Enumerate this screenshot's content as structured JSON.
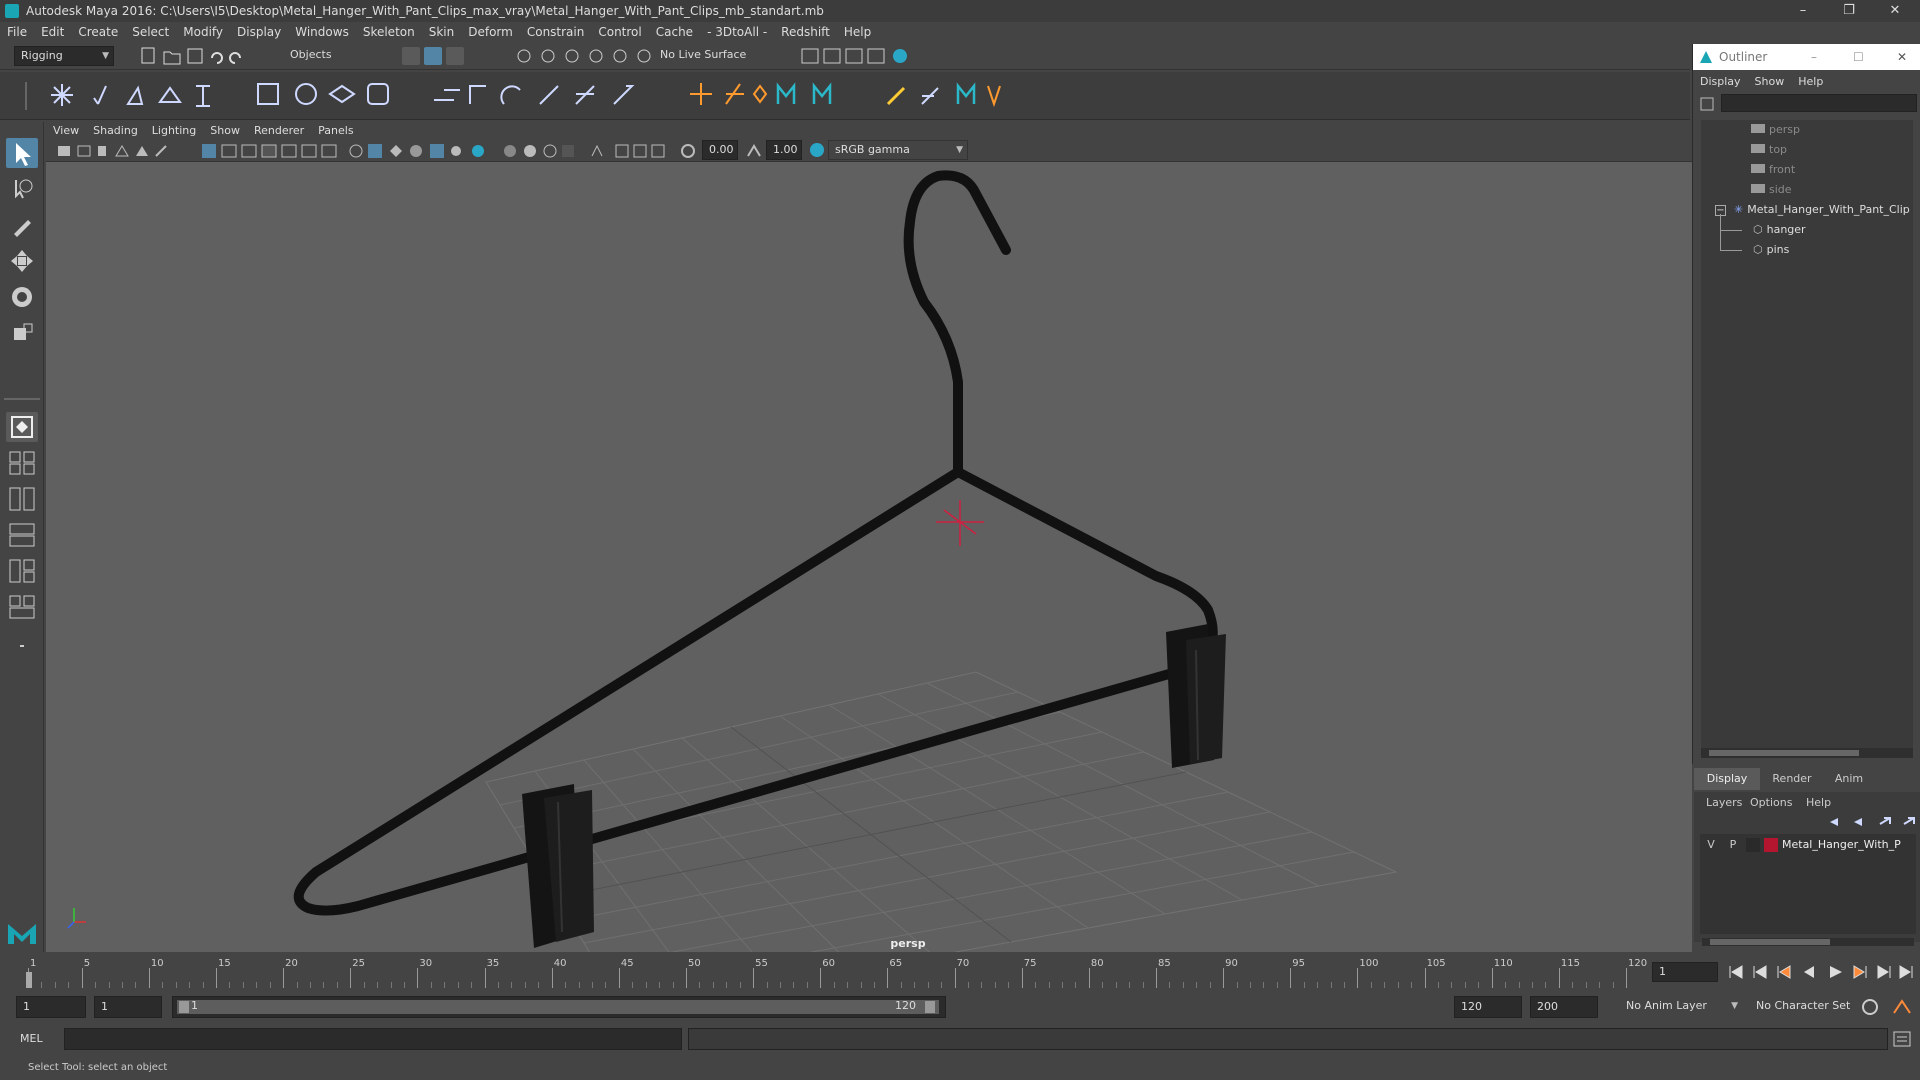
{
  "window": {
    "title": "Autodesk Maya 2016: C:\\Users\\I5\\Desktop\\Metal_Hanger_With_Pant_Clips_max_vray\\Metal_Hanger_With_Pant_Clips_mb_standart.mb",
    "minimize": "–",
    "restore": "❐",
    "close": "✕"
  },
  "menubar": [
    "File",
    "Edit",
    "Create",
    "Select",
    "Modify",
    "Display",
    "Windows",
    "Skeleton",
    "Skin",
    "Deform",
    "Constrain",
    "Control",
    "Cache",
    "- 3DtoAll -",
    "Redshift",
    "Help"
  ],
  "statusline": {
    "mode": "Rigging",
    "selection_mask": "Objects",
    "live_surface": "No Live Surface"
  },
  "panel_menu": [
    "View",
    "Shading",
    "Lighting",
    "Show",
    "Renderer",
    "Panels"
  ],
  "viewbar": {
    "exposure": "0.00",
    "gamma": "1.00",
    "color_space": "sRGB gamma"
  },
  "viewport": {
    "camera_label": "persp"
  },
  "outliner": {
    "title": "Outliner",
    "menu": [
      "Display",
      "Show",
      "Help"
    ],
    "items": [
      {
        "label": "persp",
        "dim": true
      },
      {
        "label": "top",
        "dim": true
      },
      {
        "label": "front",
        "dim": true
      },
      {
        "label": "side",
        "dim": true
      },
      {
        "label": "Metal_Hanger_With_Pant_Clip",
        "dim": false
      },
      {
        "label": "hanger",
        "dim": false
      },
      {
        "label": "pins",
        "dim": false
      }
    ]
  },
  "layer_editor": {
    "tabs": [
      "Display",
      "Render",
      "Anim"
    ],
    "menu": [
      "Layers",
      "Options",
      "Help"
    ],
    "layer": {
      "v": "V",
      "p": "P",
      "name": "Metal_Hanger_With_P",
      "color": "#b3162e"
    }
  },
  "timeline": {
    "ticks": [
      "1",
      "5",
      "10",
      "15",
      "20",
      "25",
      "30",
      "35",
      "40",
      "45",
      "50",
      "55",
      "60",
      "65",
      "70",
      "75",
      "80",
      "85",
      "90",
      "95",
      "100",
      "105",
      "110",
      "115",
      "120"
    ],
    "current_frame": "1"
  },
  "range": {
    "start": "1",
    "playback_start": "1",
    "slider_start": "1",
    "slider_end": "120",
    "playback_end": "120",
    "end": "200",
    "anim_layer": "No Anim Layer",
    "character_set": "No Character Set"
  },
  "cmdline": {
    "lang": "MEL"
  },
  "helpline": {
    "text": "Select Tool: select an object"
  },
  "colors": {
    "accent": "#5285a6",
    "maya_teal": "#1aa5b5"
  }
}
